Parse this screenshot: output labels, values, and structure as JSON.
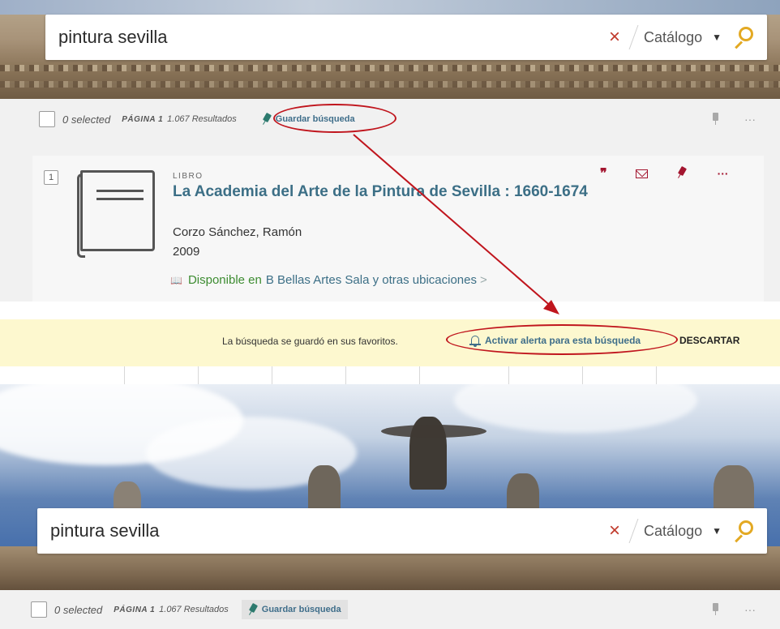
{
  "top_panel": {
    "search": {
      "query": "pintura sevilla",
      "scope": "Catálogo"
    },
    "toolbar": {
      "selected": "0 selected",
      "page": "PÁGINA 1",
      "results": "1.067 Resultados",
      "save_search": "Guardar búsqueda"
    },
    "result": {
      "number": "1",
      "type": "LIBRO",
      "title": "La Academia del Arte de la Pintura de Sevilla : 1660-1674",
      "author": "Corzo Sánchez, Ramón",
      "year": "2009",
      "availability_status": "Disponible en",
      "availability_location": "B Bellas Artes  Sala y otras ubicaciones",
      "availability_chevron": ">"
    }
  },
  "banner": {
    "message": "La búsqueda se guardó en sus favoritos.",
    "alert_action": "Activar alerta para esta búsqueda",
    "dismiss": "DESCARTAR"
  },
  "bottom_panel": {
    "search": {
      "query": "pintura sevilla",
      "scope": "Catálogo"
    },
    "toolbar": {
      "selected": "0 selected",
      "page": "PÁGINA 1",
      "results": "1.067 Resultados",
      "save_search": "Guardar búsqueda"
    }
  },
  "colors": {
    "accent_link": "#3c6f86",
    "brand_red": "#a3152f",
    "search_icon": "#e3a923",
    "available_green": "#3d8c31",
    "banner_bg": "#fdf8cf",
    "annotation_red": "#c0151d"
  },
  "icons": {
    "clear": "×",
    "caret": "▼",
    "more": "···",
    "cite": "❞",
    "book_small": "📖"
  }
}
